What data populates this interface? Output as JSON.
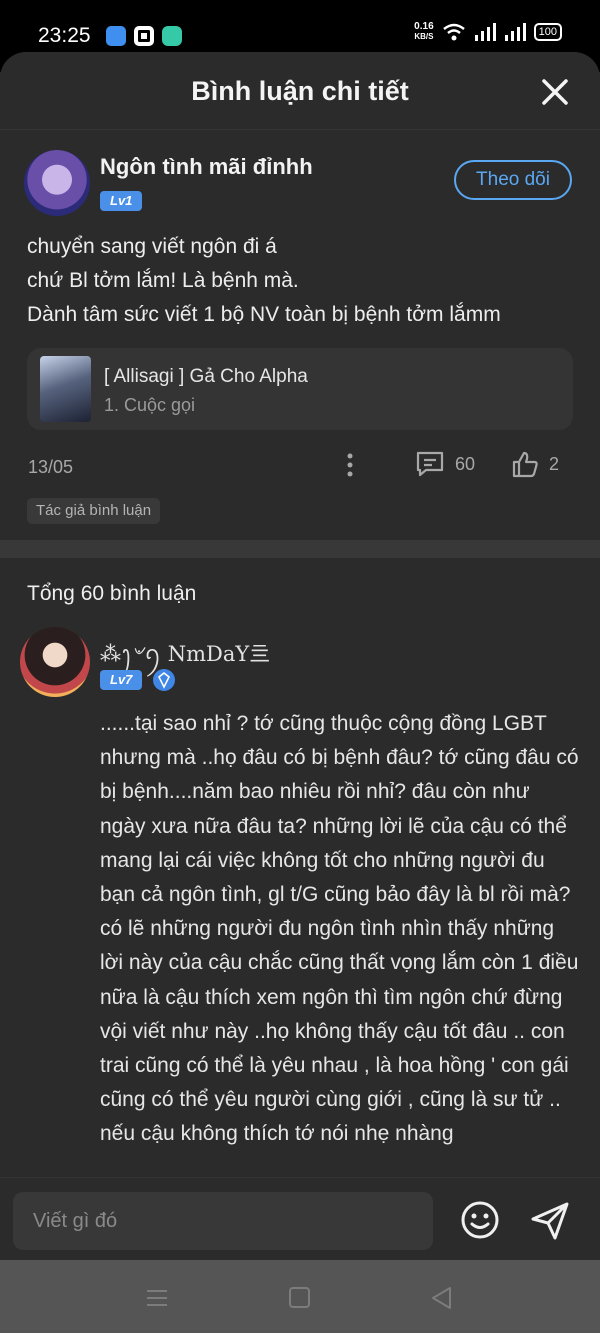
{
  "status_bar": {
    "time": "23:25",
    "net_speed": "0.16",
    "net_unit": "KB/S",
    "battery": "100"
  },
  "header": {
    "title": "Bình luận chi tiết"
  },
  "post": {
    "author": "Ngôn tình mãi đỉnhh",
    "level": "Lv1",
    "follow_label": "Theo dõi",
    "body": [
      "chuyển sang viết ngôn đi á",
      "chứ Bl tởm lắm! Là bệnh mà.",
      "Dành tâm sức viết 1 bộ NV toàn bị bệnh tởm lắmm"
    ],
    "book": {
      "title": "[ Allisagi ] Gả Cho Alpha",
      "chapter": "1. Cuộc gọi"
    },
    "date": "13/05",
    "comment_count": "60",
    "like_count": "2",
    "tag": "Tác giả bình luận"
  },
  "comments": {
    "total_label": "Tổng 60 bình luận",
    "first": {
      "name": "⁂ꫂ৺ꪆ NmDaY亖",
      "level": "Lv7",
      "body": "......tại sao nhỉ ? tớ cũng thuộc cộng đồng LGBT nhưng mà ..họ đâu có bị bệnh đâu? tớ cũng đâu có bị bệnh....năm bao nhiêu rồi nhỉ? đâu còn như ngày xưa nữa đâu ta? những lời lẽ của cậu có thể mang lại cái việc không tốt cho những người đu bạn cả ngôn tình, gl t/G cũng bảo đây là bl rồi mà? có lẽ những người đu ngôn tình nhìn thấy những lời này của cậu chắc cũng thất vọng lắm còn 1 điều nữa là cậu thích xem ngôn thì tìm ngôn chứ đừng vội viết như này ..họ không thấy cậu tốt đâu .. con trai cũng có thể là yêu nhau , là hoa hồng ' con gái cũng có thể yêu người cùng giới , cũng là sư tử .. nếu cậu không thích tớ nói nhẹ nhàng"
    }
  },
  "input": {
    "placeholder": "Viết gì đó"
  },
  "colors": {
    "accent": "#5aa7f2",
    "badge": "#4a8fe8",
    "sheet_bg": "#2b2b2b"
  }
}
